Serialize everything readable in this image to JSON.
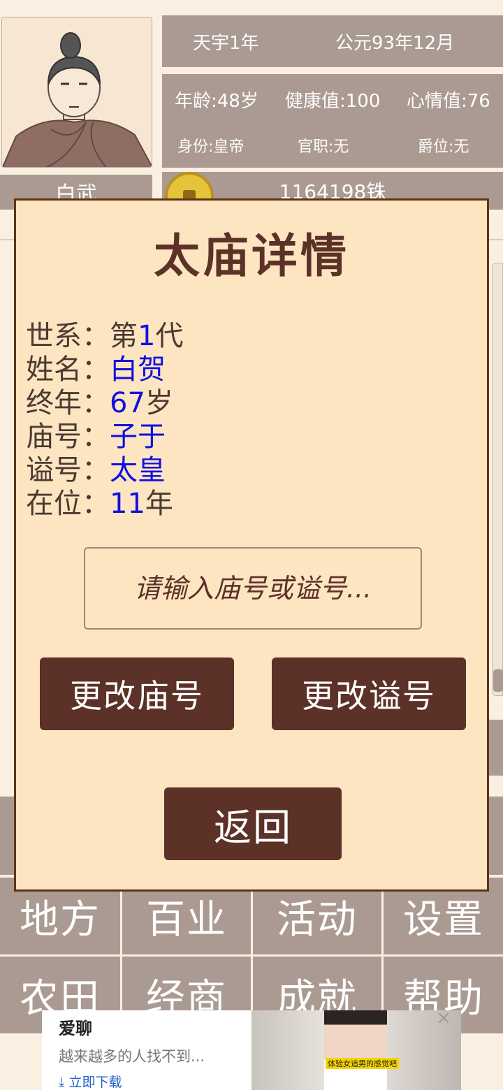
{
  "header": {
    "era": "天宇1年",
    "calendar": "公元93年12月"
  },
  "stats": {
    "age": "年龄:48岁",
    "health": "健康值:100",
    "mood": "心情值:76",
    "identity": "身份:皇帝",
    "office": "官职:无",
    "title": "爵位:无"
  },
  "player": {
    "name": "白武",
    "money": "1164198铢"
  },
  "modal": {
    "title": "太庙详情",
    "rows": [
      {
        "key": "世系：",
        "prefix": "第",
        "value": "1",
        "suffix": "代"
      },
      {
        "key": "姓名：",
        "prefix": "",
        "value": "白贺",
        "suffix": ""
      },
      {
        "key": "终年：",
        "prefix": "",
        "value": "67",
        "suffix": "岁"
      },
      {
        "key": "庙号：",
        "prefix": "",
        "value": "子于",
        "suffix": ""
      },
      {
        "key": "谥号：",
        "prefix": "",
        "value": "太皇",
        "suffix": ""
      },
      {
        "key": "在位：",
        "prefix": "",
        "value": "11",
        "suffix": "年"
      }
    ],
    "input_placeholder": "请输入庙号或谥号...",
    "btn_temple": "更改庙号",
    "btn_posthumous": "更改谥号",
    "btn_back": "返回"
  },
  "menu": [
    "地方",
    "百业",
    "活动",
    "设置",
    "农田",
    "经商",
    "成就",
    "帮助"
  ],
  "ad": {
    "title": "爱聊",
    "subtitle": "越来越多的人找不到...",
    "download": "立即下载",
    "caption": "体验女追男的感觉吧",
    "close": "×"
  },
  "colors": {
    "modal_bg": "#fde5c2",
    "modal_border": "#5f3416",
    "button_brown": "#5c3127",
    "value_blue": "#1010e0",
    "bar_gray": "#ab9a92",
    "page_bg": "#faf0e1"
  }
}
